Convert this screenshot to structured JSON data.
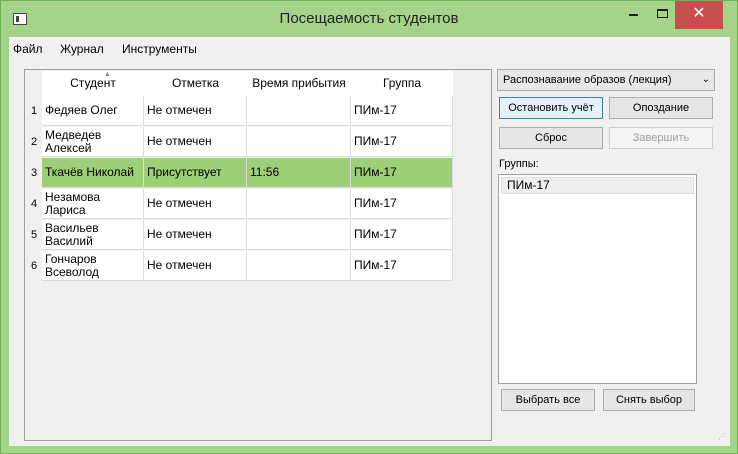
{
  "window": {
    "title": "Посещаемость студентов",
    "min_glyph": "–",
    "max_glyph": "□",
    "close_glyph": "✕"
  },
  "menu": [
    "Файл",
    "Журнал",
    "Инструменты"
  ],
  "table": {
    "columns": [
      "Студент",
      "Отметка",
      "Время прибытия",
      "Группа"
    ],
    "rows": [
      {
        "num": "1",
        "student": "Федяев Олег",
        "mark": "Не отмечен",
        "time": "",
        "group": "ПИм-17",
        "selected": false
      },
      {
        "num": "2",
        "student": "Медведев Алексей",
        "mark": "Не отмечен",
        "time": "",
        "group": "ПИм-17",
        "selected": false
      },
      {
        "num": "3",
        "student": "Ткачёв Николай",
        "mark": "Присутствует",
        "time": "11:56",
        "group": "ПИм-17",
        "selected": true
      },
      {
        "num": "4",
        "student": "Незамова Лариса",
        "mark": "Не отмечен",
        "time": "",
        "group": "ПИм-17",
        "selected": false
      },
      {
        "num": "5",
        "student": "Васильев Василий",
        "mark": "Не отмечен",
        "time": "",
        "group": "ПИм-17",
        "selected": false
      },
      {
        "num": "6",
        "student": "Гончаров Всеволод",
        "mark": "Не отмечен",
        "time": "",
        "group": "ПИм-17",
        "selected": false
      }
    ]
  },
  "lecture_select": {
    "value": "Распознавание образов (лекция)"
  },
  "buttons": {
    "stop_tracking": "Остановить учёт",
    "late": "Опоздание",
    "reset": "Сброс",
    "finish": "Завершить",
    "select_all": "Выбрать все",
    "deselect": "Снять выбор"
  },
  "groups": {
    "label": "Группы:",
    "items": [
      "ПИм-17"
    ]
  },
  "colors": {
    "accent": "#a5d38a",
    "selected_row": "#9ccf77",
    "close_button": "#c7504f"
  }
}
